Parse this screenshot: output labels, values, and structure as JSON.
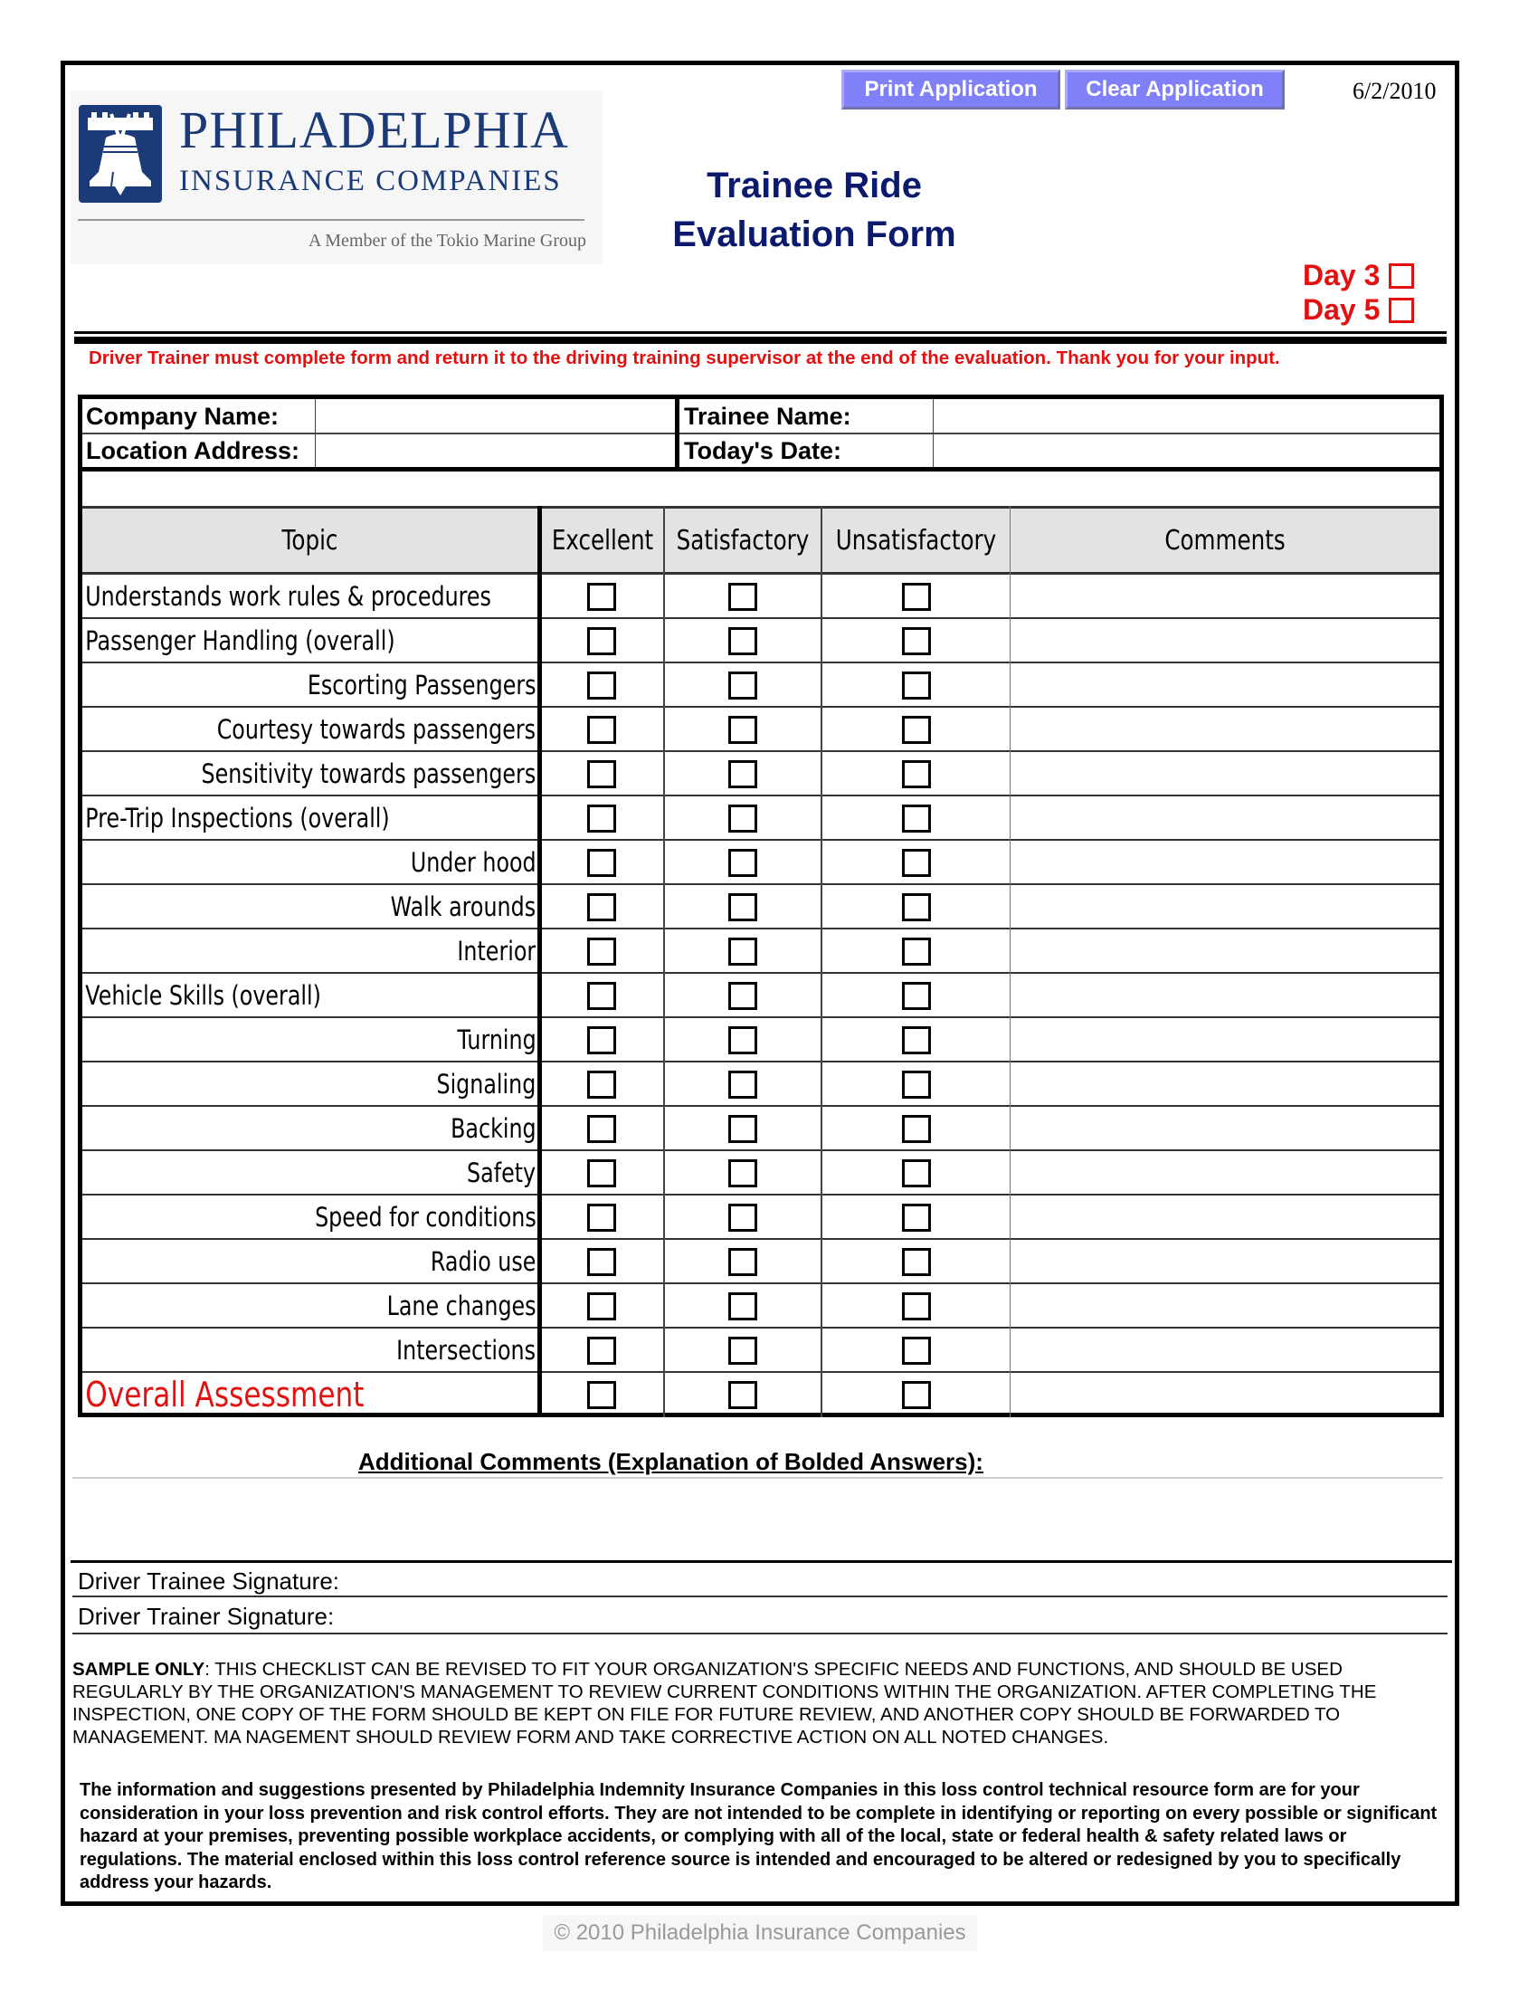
{
  "header": {
    "logo": {
      "name_line1": "PHILADELPHIA",
      "name_line2": "INSURANCE COMPANIES",
      "tagline": "A Member of the Tokio Marine Group",
      "icon": "liberty-bell-icon",
      "brand_color": "#1a3a78"
    },
    "buttons": {
      "print_label": "Print Application",
      "clear_label": "Clear Application",
      "color": "#8080f8"
    },
    "date": "6/2/2010",
    "title_line1": "Trainee Ride",
    "title_line2": "Evaluation Form",
    "title_color": "#0c1a6e",
    "day_options": [
      {
        "label": "Day 3",
        "checked": false
      },
      {
        "label": "Day 5",
        "checked": false
      }
    ],
    "accent_red": "#e41010"
  },
  "note": "Driver Trainer must complete form and return it to the driving training supervisor at the end of the evaluation. Thank you for your input.",
  "info_fields": {
    "company_name_label": "Company Name:",
    "company_name_value": "",
    "location_address_label": "Location Address:",
    "location_address_value": "",
    "trainee_name_label": "Trainee Name:",
    "trainee_name_value": "",
    "todays_date_label": "Today's Date:",
    "todays_date_value": ""
  },
  "table": {
    "headers": [
      "Topic",
      "Excellent",
      "Satisfactory",
      "Unsatisfactory",
      "Comments"
    ],
    "rows": [
      {
        "topic": "Understands work rules & procedures",
        "level": "main"
      },
      {
        "topic": "Passenger Handling (overall)",
        "level": "main"
      },
      {
        "topic": "Escorting Passengers",
        "level": "sub"
      },
      {
        "topic": "Courtesy towards passengers",
        "level": "sub"
      },
      {
        "topic": "Sensitivity towards passengers",
        "level": "sub"
      },
      {
        "topic": "Pre-Trip Inspections (overall)",
        "level": "main"
      },
      {
        "topic": "Under hood",
        "level": "sub"
      },
      {
        "topic": "Walk arounds",
        "level": "sub"
      },
      {
        "topic": "Interior",
        "level": "sub"
      },
      {
        "topic": "Vehicle Skills (overall)",
        "level": "main"
      },
      {
        "topic": "Turning",
        "level": "sub"
      },
      {
        "topic": "Signaling",
        "level": "sub"
      },
      {
        "topic": "Backing",
        "level": "sub"
      },
      {
        "topic": "Safety",
        "level": "sub"
      },
      {
        "topic": "Speed for conditions",
        "level": "sub"
      },
      {
        "topic": "Radio use",
        "level": "sub"
      },
      {
        "topic": "Lane changes",
        "level": "sub"
      },
      {
        "topic": "Intersections",
        "level": "sub"
      },
      {
        "topic": "Overall Assessment",
        "level": "total"
      }
    ]
  },
  "additional_comments_label": "Additional Comments (Explanation of Bolded Answers):",
  "signatures": {
    "trainee_label": "Driver Trainee Signature:",
    "trainer_label": "Driver Trainer Signature:"
  },
  "sample_notice": {
    "bold_prefix": "SAMPLE ONLY",
    "text": ": THIS CHECKLIST CAN BE REVISED TO FIT YOUR ORGANIZATION'S SPECIFIC NEEDS AND FUNCTIONS, AND SHOULD BE USED REGULARLY BY THE ORGANIZATION'S MANAGEMENT TO REVIEW CURRENT CONDITIONS WITHIN THE ORGANIZATION. AFTER COMPLETING THE INSPECTION, ONE COPY OF THE FORM SHOULD BE KEPT ON FILE FOR FUTURE REVIEW, AND ANOTHER COPY SHOULD BE FORWARDED TO MANAGEMENT.  MA NAGEMENT SHOULD REVIEW FORM AND TAKE CORRECTIVE ACTION ON ALL NOTED CHANGES."
  },
  "disclaimer": "The information and suggestions presented by Philadelphia Indemnity Insurance Companies in this loss control technical resource form are for your consideration in your loss prevention and risk control efforts. They are not intended to be complete in identifying or reporting on every possible or significant hazard at your premises, preventing possible workplace accidents, or complying with all of the local, state or federal health & safety related laws or regulations. The material enclosed within this loss control reference source is intended and encouraged to be altered or redesigned by you to specifically address your hazards.",
  "copyright": "© 2010 Philadelphia Insurance Companies"
}
